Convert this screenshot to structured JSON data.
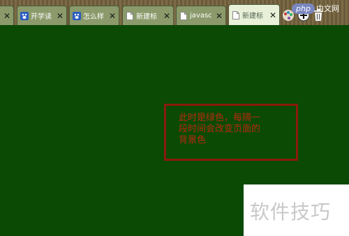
{
  "tabs": [
    {
      "title": "",
      "icon": "none",
      "active": false
    },
    {
      "title": "开学读",
      "icon": "paw-icon",
      "active": false
    },
    {
      "title": "怎么样",
      "icon": "paw-icon",
      "active": false
    },
    {
      "title": "新建标",
      "icon": "document-icon",
      "active": false
    },
    {
      "title": "javasc",
      "icon": "document-icon",
      "active": false
    },
    {
      "title": "新建标",
      "icon": "document-icon",
      "active": true
    }
  ],
  "close_glyph": "✕",
  "note": {
    "line1": "此时是绿色，每隔一",
    "line2": "段时间会改变页面的",
    "line3": "背景色"
  },
  "logo": {
    "php": "php",
    "cn": "中文网"
  },
  "watermark": "软件技巧",
  "colors": {
    "page_background": "#0a4a05",
    "note_border": "#8b1a0c",
    "note_text": "#b82a10"
  }
}
